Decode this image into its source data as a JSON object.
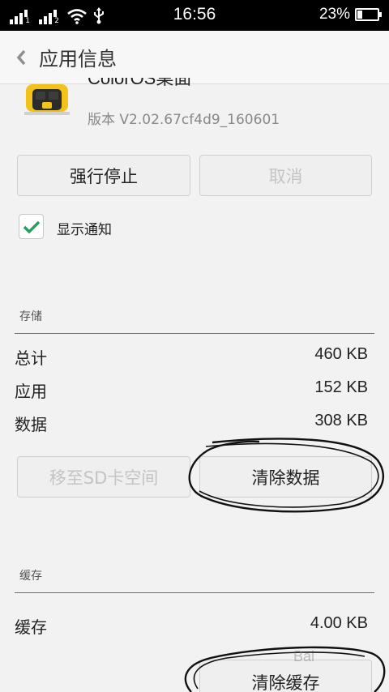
{
  "status_bar": {
    "time": "16:56",
    "battery_percent_text": "23%",
    "battery_level": 0.23,
    "sim1": "1",
    "sim2": "2",
    "icons": [
      "signal-icon",
      "signal-icon",
      "wifi-icon",
      "usb-icon",
      "battery-icon"
    ]
  },
  "header": {
    "title": "应用信息",
    "back_icon": "chevron-left-icon"
  },
  "app": {
    "name": "ColorOS桌面",
    "version": "版本 V2.02.67cf4d9_160601",
    "icon": "app-icon"
  },
  "actions": {
    "force_stop": "强行停止",
    "cancel": "取消"
  },
  "notification": {
    "label": "显示通知",
    "checked": true
  },
  "storage": {
    "section_label": "存储",
    "rows": [
      {
        "label": "总计",
        "value": "460 KB"
      },
      {
        "label": "应用",
        "value": "152 KB"
      },
      {
        "label": "数据",
        "value": "308 KB"
      }
    ],
    "move_button": "移至SD卡空间",
    "clear_data_button": "清除数据"
  },
  "cache": {
    "section_label": "缓存",
    "row": {
      "label": "缓存",
      "value": "4.00 KB"
    },
    "clear_cache_button": "清除缓存"
  },
  "colors": {
    "accent_green": "#2f8f6a",
    "check_green": "#23a15b",
    "background": "#f2f2f2"
  }
}
